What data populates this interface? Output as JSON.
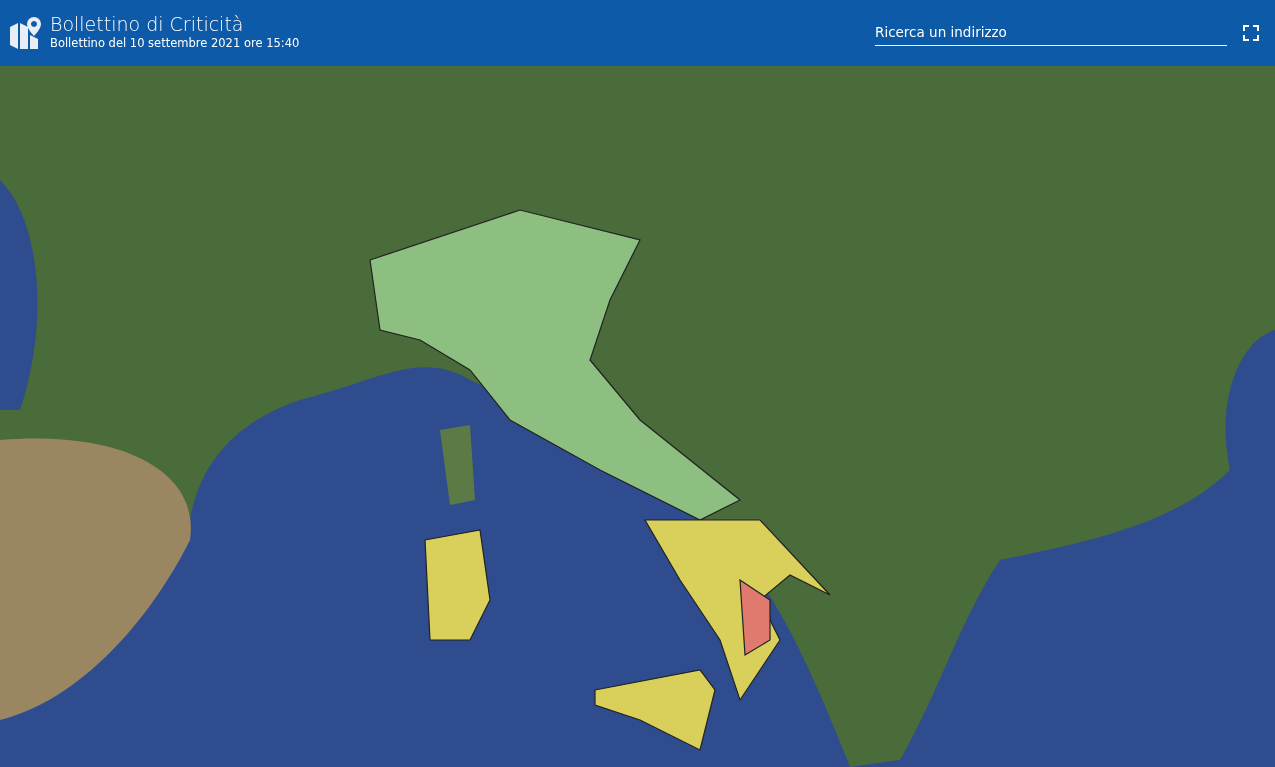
{
  "header": {
    "title": "Bollettino di Criticità",
    "subtitle": "Bollettino del 10 settembre 2021 ore 15:40",
    "search": {
      "placeholder": "Ricerca un indirizzo"
    }
  }
}
